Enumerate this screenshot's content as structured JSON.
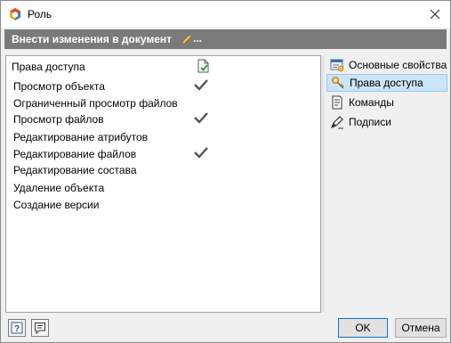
{
  "window": {
    "title": "Роль"
  },
  "banner": {
    "text": "Внести изменения в документ",
    "suffix": "..."
  },
  "access_list": {
    "header": "Права доступа",
    "rows": [
      {
        "label": "Просмотр объекта",
        "checked": true
      },
      {
        "label": "Ограниченный просмотр файлов",
        "checked": false
      },
      {
        "label": "Просмотр файлов",
        "checked": true
      },
      {
        "label": "Редактирование атрибутов",
        "checked": false
      },
      {
        "label": "Редактирование файлов",
        "checked": true
      },
      {
        "label": "Редактирование состава",
        "checked": false
      },
      {
        "label": "Удаление объекта",
        "checked": false
      },
      {
        "label": "Создание версии",
        "checked": false
      }
    ]
  },
  "nav": {
    "items": [
      {
        "label": "Основные свойства",
        "icon": "properties-icon",
        "selected": false
      },
      {
        "label": "Права доступа",
        "icon": "keys-icon",
        "selected": true
      },
      {
        "label": "Команды",
        "icon": "commands-icon",
        "selected": false
      },
      {
        "label": "Подписи",
        "icon": "signature-icon",
        "selected": false
      }
    ]
  },
  "footer": {
    "ok_label": "OK",
    "cancel_label": "Отмена",
    "help_icon": "help-icon",
    "comment_icon": "comment-icon"
  },
  "colors": {
    "banner_bg": "#7a7a7a",
    "selection_bg": "#cce4f7",
    "check": "#555555"
  }
}
